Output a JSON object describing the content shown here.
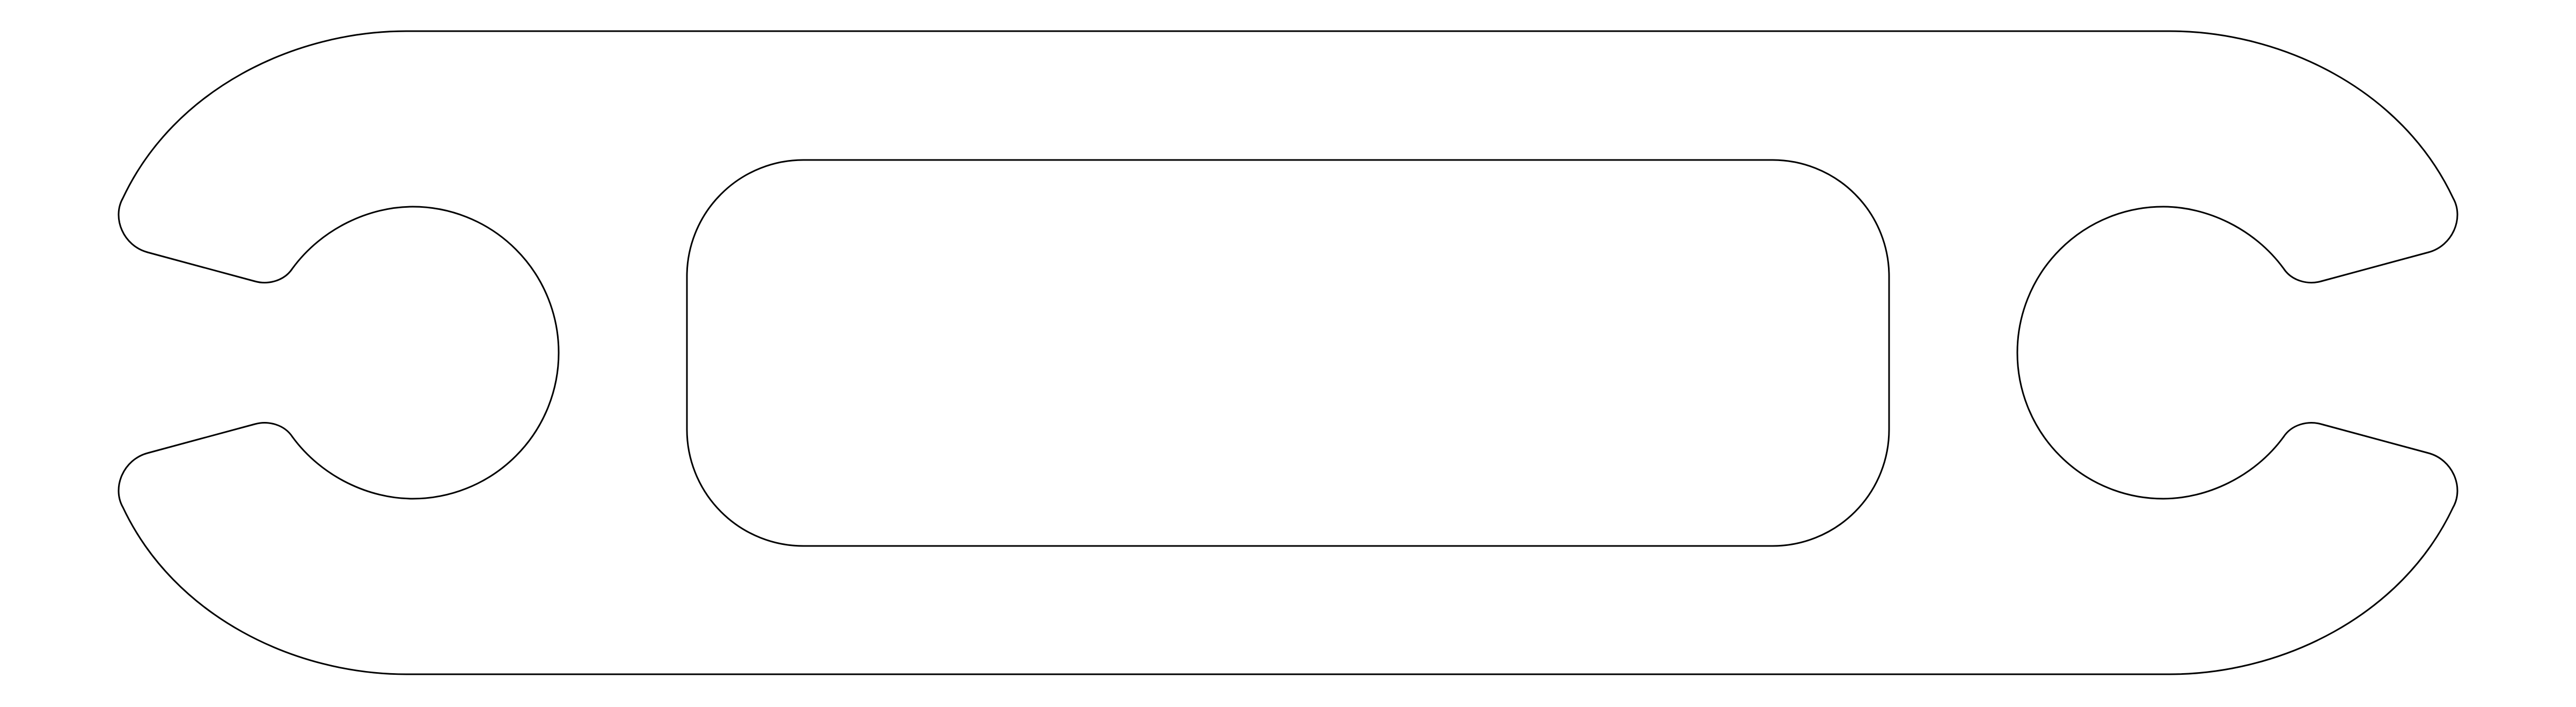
{
  "drawing": {
    "background": "#ffffff",
    "stroke_color": "#000000",
    "shapes": [
      {
        "name": "outer-profile",
        "kind": "closed-outline"
      },
      {
        "name": "center-slot",
        "kind": "rounded-rectangle-cutout"
      },
      {
        "name": "left-keyhole",
        "kind": "circular-notch-open-left"
      },
      {
        "name": "right-keyhole",
        "kind": "circular-notch-open-right"
      }
    ]
  }
}
